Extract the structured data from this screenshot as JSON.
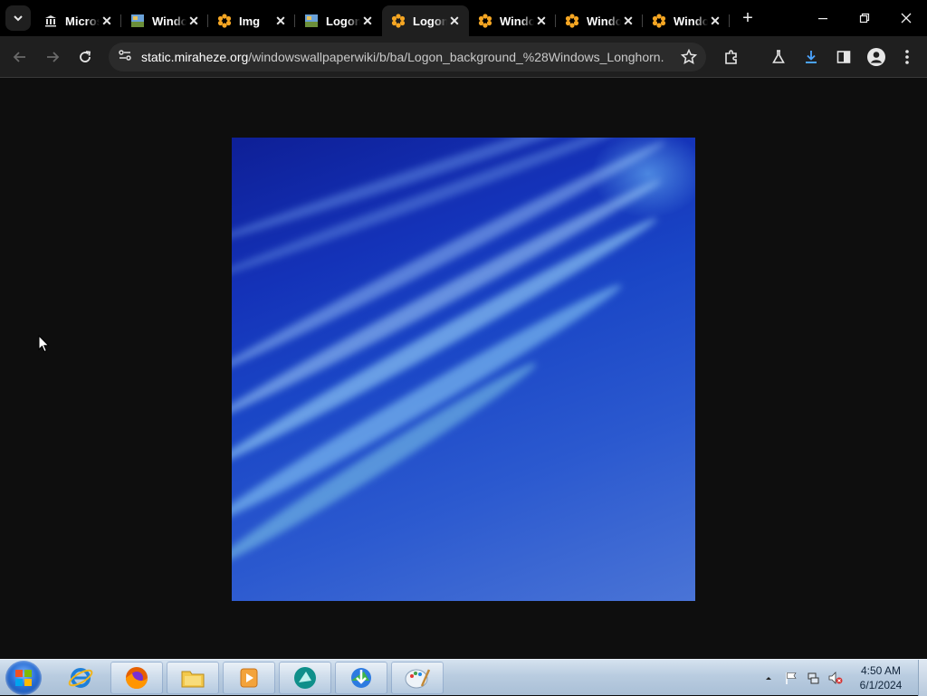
{
  "browser": {
    "tabs": [
      {
        "title": "Microsoft",
        "favicon": "museum-icon",
        "active": false
      },
      {
        "title": "Windows",
        "favicon": "wallpaper-thumb-icon",
        "active": false
      },
      {
        "title": "Img",
        "favicon": "miraheze-flower-icon",
        "active": false
      },
      {
        "title": "Logon",
        "favicon": "wallpaper-thumb-icon",
        "active": false
      },
      {
        "title": "Logon",
        "favicon": "miraheze-flower-icon",
        "active": true
      },
      {
        "title": "Windows",
        "favicon": "miraheze-flower-icon",
        "active": false
      },
      {
        "title": "Windows",
        "favicon": "miraheze-flower-icon",
        "active": false
      },
      {
        "title": "Windows",
        "favicon": "miraheze-flower-icon",
        "active": false
      }
    ],
    "url_host": "static.miraheze.org",
    "url_path": "/windowswallpaperwiki/b/ba/Logon_background_%28Windows_Longhorn..."
  },
  "taskbar": {
    "apps": [
      "internet-explorer-icon",
      "firefox-icon",
      "file-explorer-icon",
      "media-player-icon",
      "app-teal-icon",
      "download-manager-icon",
      "paint-icon"
    ],
    "clock_time": "4:50 AM",
    "clock_date": "6/1/2024"
  },
  "colors": {
    "tab_bg": "#000000",
    "toolbar_bg": "#1f1f1f",
    "page_bg": "#0e0e0e",
    "favicon_orange": "#f5a623"
  }
}
